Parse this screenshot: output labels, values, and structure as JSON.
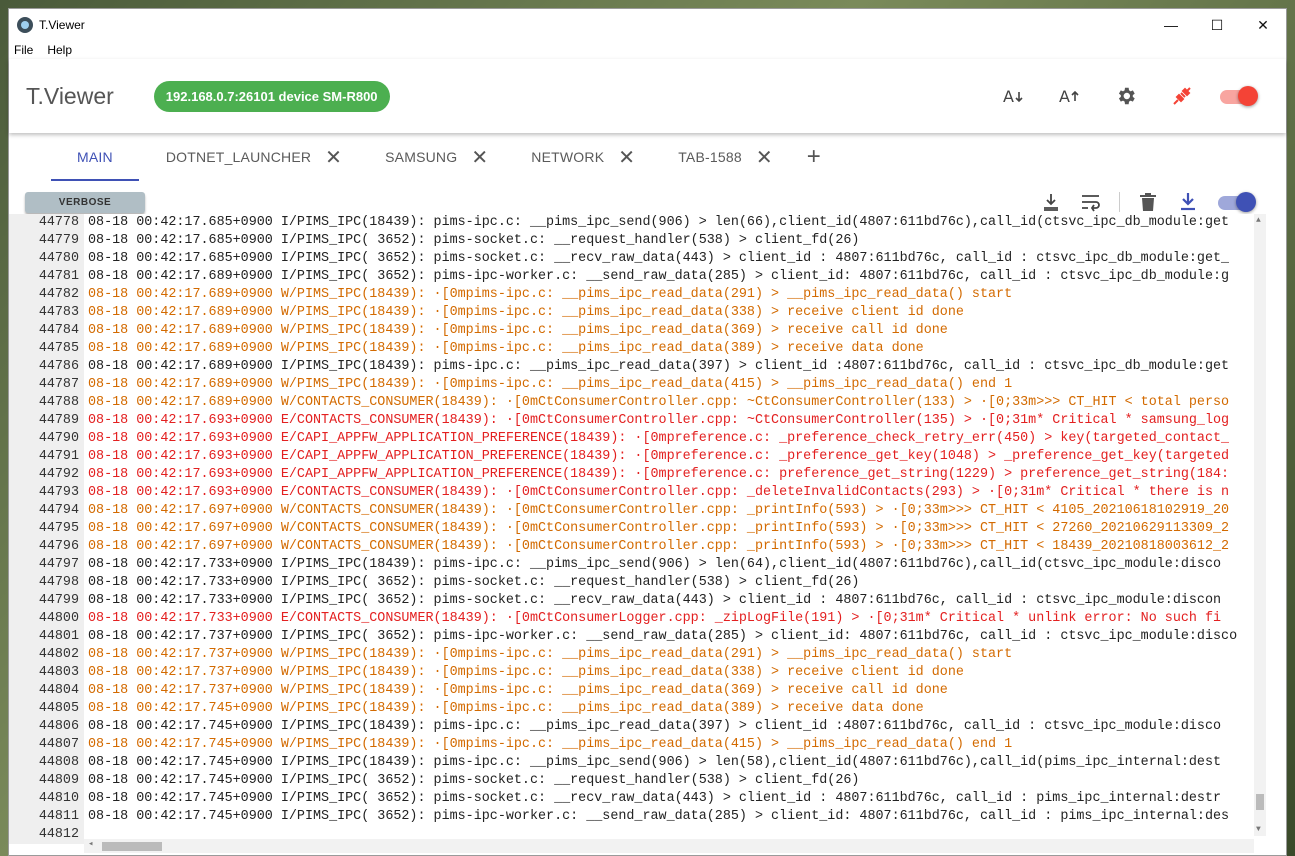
{
  "window": {
    "title": "T.Viewer",
    "controls": [
      "—",
      "☐",
      "✕"
    ]
  },
  "menu": [
    "File",
    "Help"
  ],
  "appbar": {
    "name": "T.Viewer",
    "device": "192.168.0.7:26101 device SM-R800"
  },
  "colors": {
    "accent": "#3f51b5",
    "chip": "#4caf50",
    "warn": "#d36a00",
    "error": "#e32020",
    "toggle_red": "#f44336"
  },
  "tabs": [
    {
      "label": "MAIN",
      "active": true
    },
    {
      "label": "DOTNET_LAUNCHER"
    },
    {
      "label": "SAMSUNG"
    },
    {
      "label": "NETWORK"
    },
    {
      "label": "TAB-1588"
    }
  ],
  "toolbar": {
    "verbose_label": "VERBOSE"
  },
  "log": [
    {
      "n": "44778",
      "l": "i",
      "t": "08-18 00:42:17.685+0900 I/PIMS_IPC(18439): pims-ipc.c: __pims_ipc_send(906) > len(66),client_id(4807:611bd76c),call_id(ctsvc_ipc_db_module:get"
    },
    {
      "n": "44779",
      "l": "i",
      "t": "08-18 00:42:17.685+0900 I/PIMS_IPC( 3652): pims-socket.c: __request_handler(538) > client_fd(26)"
    },
    {
      "n": "44780",
      "l": "i",
      "t": "08-18 00:42:17.685+0900 I/PIMS_IPC( 3652): pims-socket.c: __recv_raw_data(443) > client_id : 4807:611bd76c, call_id : ctsvc_ipc_db_module:get_"
    },
    {
      "n": "44781",
      "l": "i",
      "t": "08-18 00:42:17.689+0900 I/PIMS_IPC( 3652): pims-ipc-worker.c: __send_raw_data(285) > client_id: 4807:611bd76c, call_id : ctsvc_ipc_db_module:g"
    },
    {
      "n": "44782",
      "l": "w",
      "t": "08-18 00:42:17.689+0900 W/PIMS_IPC(18439): ·[0mpims-ipc.c: __pims_ipc_read_data(291) > __pims_ipc_read_data() start"
    },
    {
      "n": "44783",
      "l": "w",
      "t": "08-18 00:42:17.689+0900 W/PIMS_IPC(18439): ·[0mpims-ipc.c: __pims_ipc_read_data(338) > receive client id done"
    },
    {
      "n": "44784",
      "l": "w",
      "t": "08-18 00:42:17.689+0900 W/PIMS_IPC(18439): ·[0mpims-ipc.c: __pims_ipc_read_data(369) > receive call id done"
    },
    {
      "n": "44785",
      "l": "w",
      "t": "08-18 00:42:17.689+0900 W/PIMS_IPC(18439): ·[0mpims-ipc.c: __pims_ipc_read_data(389) > receive data done"
    },
    {
      "n": "44786",
      "l": "i",
      "t": "08-18 00:42:17.689+0900 I/PIMS_IPC(18439): pims-ipc.c: __pims_ipc_read_data(397) > client_id :4807:611bd76c, call_id : ctsvc_ipc_db_module:get"
    },
    {
      "n": "44787",
      "l": "w",
      "t": "08-18 00:42:17.689+0900 W/PIMS_IPC(18439): ·[0mpims-ipc.c: __pims_ipc_read_data(415) > __pims_ipc_read_data() end 1"
    },
    {
      "n": "44788",
      "l": "w",
      "t": "08-18 00:42:17.689+0900 W/CONTACTS_CONSUMER(18439): ·[0mCtConsumerController.cpp: ~CtConsumerController(133) > ·[0;33m>>> CT_HIT < total perso"
    },
    {
      "n": "44789",
      "l": "e",
      "t": "08-18 00:42:17.693+0900 E/CONTACTS_CONSUMER(18439): ·[0mCtConsumerController.cpp: ~CtConsumerController(135) > ·[0;31m* Critical * samsung_log"
    },
    {
      "n": "44790",
      "l": "e",
      "t": "08-18 00:42:17.693+0900 E/CAPI_APPFW_APPLICATION_PREFERENCE(18439): ·[0mpreference.c: _preference_check_retry_err(450) > key(targeted_contact_"
    },
    {
      "n": "44791",
      "l": "e",
      "t": "08-18 00:42:17.693+0900 E/CAPI_APPFW_APPLICATION_PREFERENCE(18439): ·[0mpreference.c: _preference_get_key(1048) > _preference_get_key(targeted"
    },
    {
      "n": "44792",
      "l": "e",
      "t": "08-18 00:42:17.693+0900 E/CAPI_APPFW_APPLICATION_PREFERENCE(18439): ·[0mpreference.c: preference_get_string(1229) > preference_get_string(184:"
    },
    {
      "n": "44793",
      "l": "e",
      "t": "08-18 00:42:17.693+0900 E/CONTACTS_CONSUMER(18439): ·[0mCtConsumerController.cpp: _deleteInvalidContacts(293) > ·[0;31m* Critical * there is n"
    },
    {
      "n": "44794",
      "l": "w",
      "t": "08-18 00:42:17.697+0900 W/CONTACTS_CONSUMER(18439): ·[0mCtConsumerController.cpp: _printInfo(593) > ·[0;33m>>> CT_HIT < 4105_20210618102919_20"
    },
    {
      "n": "44795",
      "l": "w",
      "t": "08-18 00:42:17.697+0900 W/CONTACTS_CONSUMER(18439): ·[0mCtConsumerController.cpp: _printInfo(593) > ·[0;33m>>> CT_HIT < 27260_20210629113309_2"
    },
    {
      "n": "44796",
      "l": "w",
      "t": "08-18 00:42:17.697+0900 W/CONTACTS_CONSUMER(18439): ·[0mCtConsumerController.cpp: _printInfo(593) > ·[0;33m>>> CT_HIT < 18439_20210818003612_2"
    },
    {
      "n": "44797",
      "l": "i",
      "t": "08-18 00:42:17.733+0900 I/PIMS_IPC(18439): pims-ipc.c: __pims_ipc_send(906) > len(64),client_id(4807:611bd76c),call_id(ctsvc_ipc_module:disco"
    },
    {
      "n": "44798",
      "l": "i",
      "t": "08-18 00:42:17.733+0900 I/PIMS_IPC( 3652): pims-socket.c: __request_handler(538) > client_fd(26)"
    },
    {
      "n": "44799",
      "l": "i",
      "t": "08-18 00:42:17.733+0900 I/PIMS_IPC( 3652): pims-socket.c: __recv_raw_data(443) > client_id : 4807:611bd76c, call_id : ctsvc_ipc_module:discon"
    },
    {
      "n": "44800",
      "l": "e",
      "t": "08-18 00:42:17.733+0900 E/CONTACTS_CONSUMER(18439): ·[0mCtConsumerLogger.cpp: _zipLogFile(191) > ·[0;31m* Critical * unlink error: No such fi"
    },
    {
      "n": "44801",
      "l": "i",
      "t": "08-18 00:42:17.737+0900 I/PIMS_IPC( 3652): pims-ipc-worker.c: __send_raw_data(285) > client_id: 4807:611bd76c, call_id : ctsvc_ipc_module:disco"
    },
    {
      "n": "44802",
      "l": "w",
      "t": "08-18 00:42:17.737+0900 W/PIMS_IPC(18439): ·[0mpims-ipc.c: __pims_ipc_read_data(291) > __pims_ipc_read_data() start"
    },
    {
      "n": "44803",
      "l": "w",
      "t": "08-18 00:42:17.737+0900 W/PIMS_IPC(18439): ·[0mpims-ipc.c: __pims_ipc_read_data(338) > receive client id done"
    },
    {
      "n": "44804",
      "l": "w",
      "t": "08-18 00:42:17.737+0900 W/PIMS_IPC(18439): ·[0mpims-ipc.c: __pims_ipc_read_data(369) > receive call id done"
    },
    {
      "n": "44805",
      "l": "w",
      "t": "08-18 00:42:17.745+0900 W/PIMS_IPC(18439): ·[0mpims-ipc.c: __pims_ipc_read_data(389) > receive data done"
    },
    {
      "n": "44806",
      "l": "i",
      "t": "08-18 00:42:17.745+0900 I/PIMS_IPC(18439): pims-ipc.c: __pims_ipc_read_data(397) > client_id :4807:611bd76c, call_id : ctsvc_ipc_module:disco"
    },
    {
      "n": "44807",
      "l": "w",
      "t": "08-18 00:42:17.745+0900 W/PIMS_IPC(18439): ·[0mpims-ipc.c: __pims_ipc_read_data(415) > __pims_ipc_read_data() end 1"
    },
    {
      "n": "44808",
      "l": "i",
      "t": "08-18 00:42:17.745+0900 I/PIMS_IPC(18439): pims-ipc.c: __pims_ipc_send(906) > len(58),client_id(4807:611bd76c),call_id(pims_ipc_internal:dest"
    },
    {
      "n": "44809",
      "l": "i",
      "t": "08-18 00:42:17.745+0900 I/PIMS_IPC( 3652): pims-socket.c: __request_handler(538) > client_fd(26)"
    },
    {
      "n": "44810",
      "l": "i",
      "t": "08-18 00:42:17.745+0900 I/PIMS_IPC( 3652): pims-socket.c: __recv_raw_data(443) > client_id : 4807:611bd76c, call_id : pims_ipc_internal:destr"
    },
    {
      "n": "44811",
      "l": "i",
      "t": "08-18 00:42:17.745+0900 I/PIMS_IPC( 3652): pims-ipc-worker.c: __send_raw_data(285) > client_id: 4807:611bd76c, call_id : pims_ipc_internal:des"
    },
    {
      "n": "44812",
      "l": "i",
      "t": ""
    }
  ]
}
